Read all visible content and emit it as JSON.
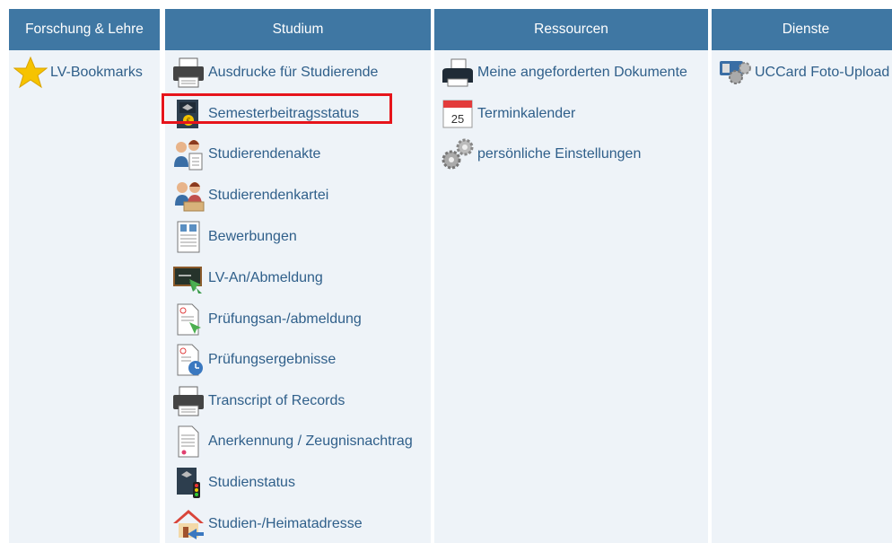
{
  "columns": {
    "forschung": {
      "title": "Forschung & Lehre",
      "items": [
        {
          "label": "LV-Bookmarks",
          "icon": "star-icon"
        }
      ]
    },
    "studium": {
      "title": "Studium",
      "items": [
        {
          "label": "Ausdrucke für Studierende",
          "icon": "printer-icon"
        },
        {
          "label": "Semesterbeitragsstatus",
          "icon": "fee-status-icon"
        },
        {
          "label": "Studierendenakte",
          "icon": "student-file-icon"
        },
        {
          "label": "Studierendenkartei",
          "icon": "student-card-icon"
        },
        {
          "label": "Bewerbungen",
          "icon": "application-document-icon"
        },
        {
          "label": "LV-An/Abmeldung",
          "icon": "course-registration-icon"
        },
        {
          "label": "Prüfungsan-/abmeldung",
          "icon": "exam-registration-icon"
        },
        {
          "label": "Prüfungsergebnisse",
          "icon": "exam-results-icon"
        },
        {
          "label": "Transcript of Records",
          "icon": "printer-icon"
        },
        {
          "label": "Anerkennung / Zeugnisnachtrag",
          "icon": "certificate-icon"
        },
        {
          "label": "Studienstatus",
          "icon": "study-status-icon"
        },
        {
          "label": "Studien-/Heimatadresse",
          "icon": "home-address-icon"
        }
      ]
    },
    "ressourcen": {
      "title": "Ressourcen",
      "items": [
        {
          "label": "Meine angeforderten Dokumente",
          "icon": "document-printer-icon"
        },
        {
          "label": "Terminkalender",
          "icon": "calendar-icon",
          "calendar_day": "25"
        },
        {
          "label": "persönliche Einstellungen",
          "icon": "gears-icon"
        }
      ]
    },
    "dienste": {
      "title": "Dienste",
      "items": [
        {
          "label": "UCCard Foto-Upload",
          "icon": "card-photo-upload-icon"
        }
      ]
    }
  },
  "highlight_color": "#e6141b",
  "header_color": "#3f77a3",
  "link_color": "#2f5f8a"
}
